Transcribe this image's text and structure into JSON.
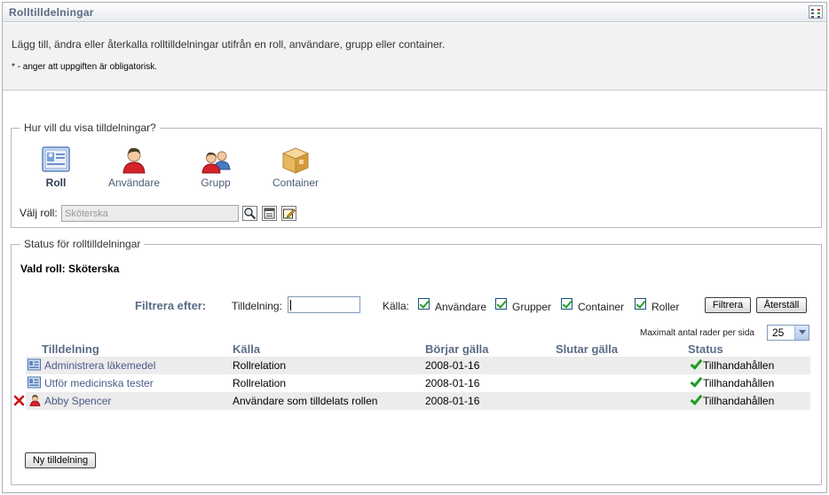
{
  "titlebar": {
    "title": "Rolltilldelningar",
    "menu_icon": "portlet-menu-icon"
  },
  "intro": {
    "description": "Lägg till, ändra eller återkalla rolltilldelningar utifrån en roll, användare, grupp eller container.",
    "required_note": "* - anger att uppgiften är obligatorisk."
  },
  "view": {
    "legend": "Hur vill du visa tilldelningar?",
    "options": [
      {
        "label": "Roll",
        "icon": "role-card-icon",
        "selected": true
      },
      {
        "label": "Användare",
        "icon": "user-icon",
        "selected": false
      },
      {
        "label": "Grupp",
        "icon": "group-icon",
        "selected": false
      },
      {
        "label": "Container",
        "icon": "container-box-icon",
        "selected": false
      }
    ],
    "select_label": "Välj roll:",
    "select_value": "Sköterska"
  },
  "status": {
    "legend": "Status för rolltilldelningar",
    "selected_role": "Vald roll: Sköterska",
    "filter": {
      "label": "Filtrera efter:",
      "assignment_label": "Tilldelning:",
      "assignment_value": "",
      "source_label": "Källa:",
      "checkboxes": [
        {
          "label": "Användare",
          "checked": true
        },
        {
          "label": "Grupper",
          "checked": true
        },
        {
          "label": "Container",
          "checked": true
        },
        {
          "label": "Roller",
          "checked": true
        }
      ],
      "filter_button": "Filtrera",
      "reset_button": "Återställ"
    },
    "max_rows_label": "Maximalt antal rader per sida",
    "max_rows_value": "25",
    "columns": [
      "Tilldelning",
      "Källa",
      "Börjar gälla",
      "Slutar gälla",
      "Status"
    ],
    "rows": [
      {
        "assignment": "Administrera läkemedel",
        "icon": "role-icon",
        "removable": false,
        "source": "Rollrelation",
        "start": "2008-01-16",
        "end": "",
        "status": "Tillhandahållen"
      },
      {
        "assignment": "Utför medicinska tester",
        "icon": "role-icon",
        "removable": false,
        "source": "Rollrelation",
        "start": "2008-01-16",
        "end": "",
        "status": "Tillhandahållen"
      },
      {
        "assignment": "Abby Spencer",
        "icon": "user-icon",
        "removable": true,
        "source": "Användare som tilldelats rollen",
        "start": "2008-01-16",
        "end": "",
        "status": "Tillhandahållen"
      }
    ],
    "new_button": "Ny tilldelning"
  },
  "colors": {
    "heading": "#5b6b86",
    "link": "#4a5a86",
    "ok": "#1f9a1f",
    "remove": "#d01010"
  }
}
